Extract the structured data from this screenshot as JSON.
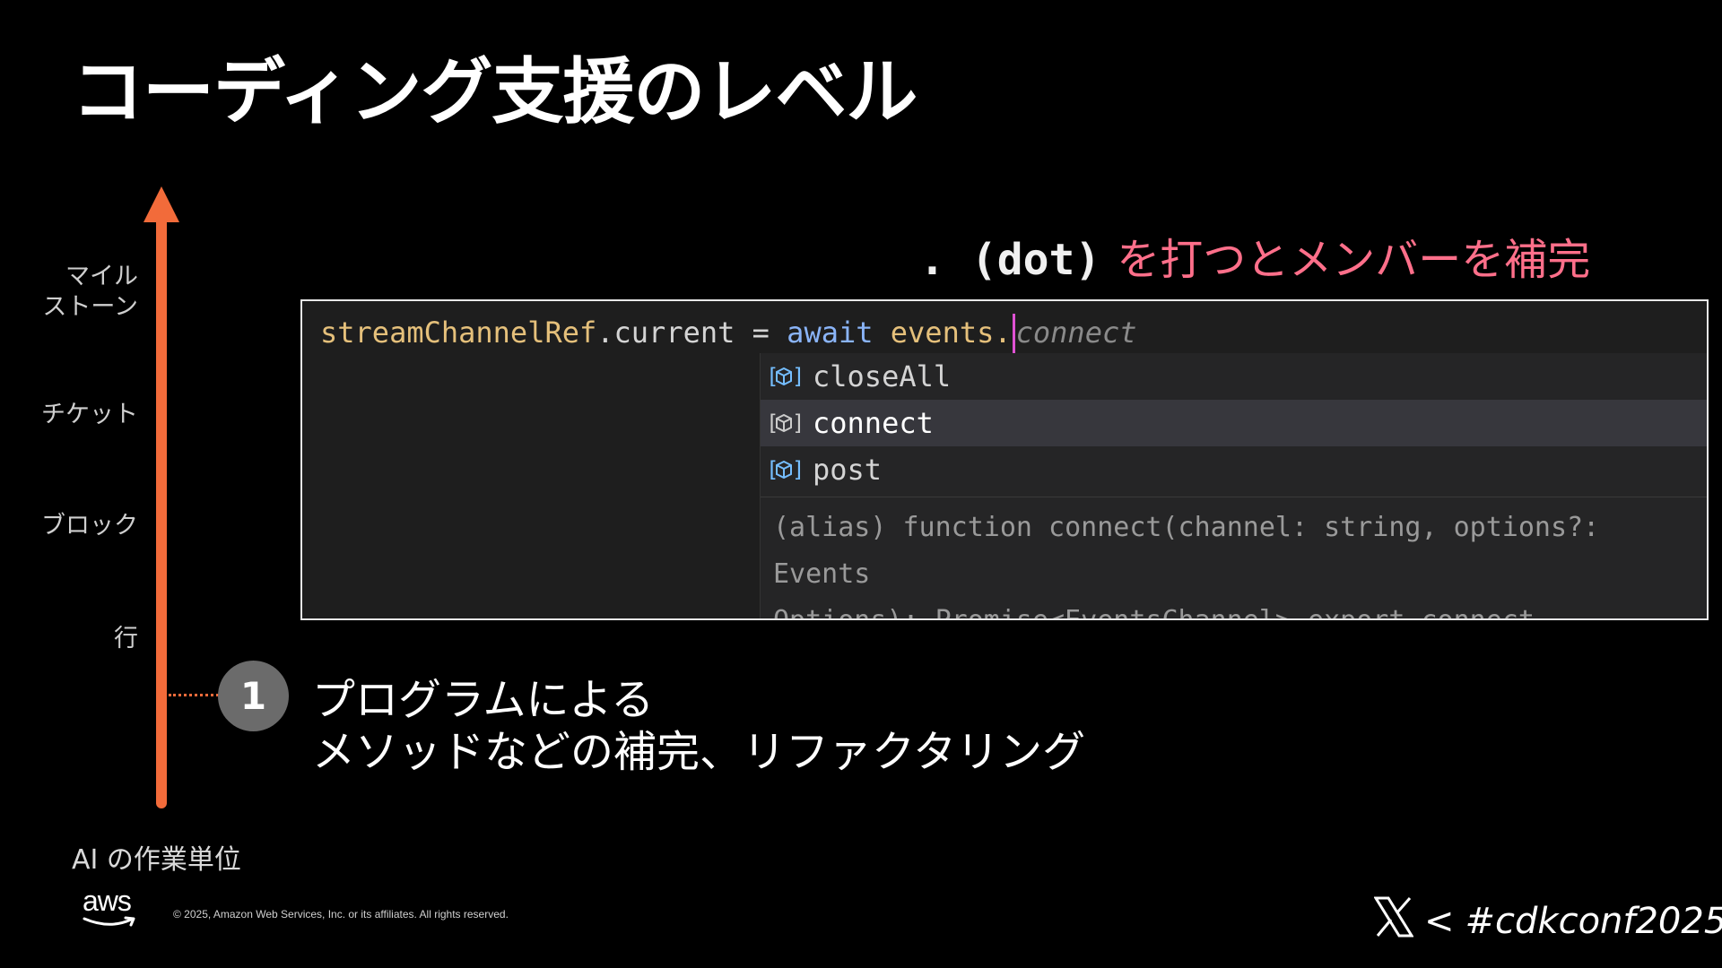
{
  "slide": {
    "title": "コーディング支援のレベル",
    "axis_caption": "AI の作業単位",
    "levels": [
      {
        "label": "マイル\nストーン"
      },
      {
        "label": "チケット"
      },
      {
        "label": "ブロック"
      },
      {
        "label": "行"
      }
    ],
    "hint_code": ". (dot)",
    "hint_text": "を打つとメンバーを補完",
    "marker_number": "1",
    "callout_line1": "プログラムによる",
    "callout_line2": "メソッドなどの補完、リファクタリング"
  },
  "editor": {
    "code_var": "streamChannelRef",
    "code_prop": ".current = ",
    "code_keyword": "await",
    "code_target": "events.",
    "ghost_text": "connect",
    "suggestions": [
      {
        "label": "closeAll",
        "icon": "method-icon",
        "selected": false
      },
      {
        "label": "connect",
        "icon": "method-icon",
        "selected": true
      },
      {
        "label": "post",
        "icon": "method-icon",
        "selected": false
      }
    ],
    "detail_line1": "(alias) function connect(channel: string, options?: Events",
    "detail_line2": "Options): Promise<EventsChannel> export connect"
  },
  "footer": {
    "aws_logo_text": "aws",
    "copyright": "© 2025, Amazon Web Services, Inc. or its affiliates. All rights reserved.",
    "hashtag_prefix": "<",
    "hashtag": "#cdkconf2025",
    "x_icon": "x-logo-icon"
  },
  "colors": {
    "accent_orange": "#f26b3a",
    "hint_pink": "#ff6f8a",
    "editor_bg": "#1e1e1e",
    "suggest_selected": "#37373d"
  }
}
